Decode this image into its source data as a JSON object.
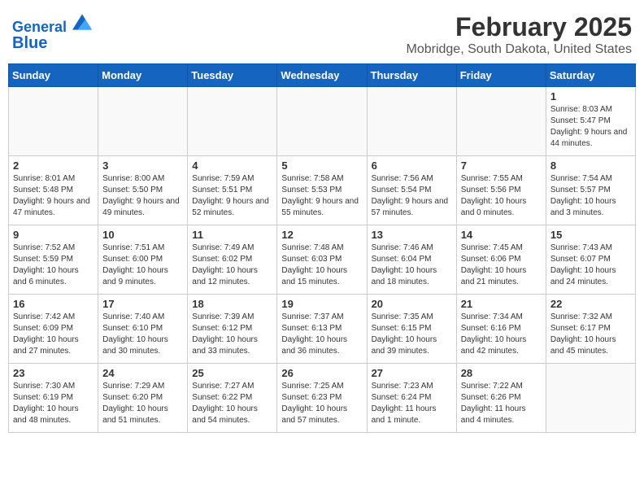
{
  "header": {
    "logo_line1": "General",
    "logo_line2": "Blue",
    "month": "February 2025",
    "location": "Mobridge, South Dakota, United States"
  },
  "days_of_week": [
    "Sunday",
    "Monday",
    "Tuesday",
    "Wednesday",
    "Thursday",
    "Friday",
    "Saturday"
  ],
  "weeks": [
    [
      {
        "day": "",
        "info": ""
      },
      {
        "day": "",
        "info": ""
      },
      {
        "day": "",
        "info": ""
      },
      {
        "day": "",
        "info": ""
      },
      {
        "day": "",
        "info": ""
      },
      {
        "day": "",
        "info": ""
      },
      {
        "day": "1",
        "info": "Sunrise: 8:03 AM\nSunset: 5:47 PM\nDaylight: 9 hours and 44 minutes."
      }
    ],
    [
      {
        "day": "2",
        "info": "Sunrise: 8:01 AM\nSunset: 5:48 PM\nDaylight: 9 hours and 47 minutes."
      },
      {
        "day": "3",
        "info": "Sunrise: 8:00 AM\nSunset: 5:50 PM\nDaylight: 9 hours and 49 minutes."
      },
      {
        "day": "4",
        "info": "Sunrise: 7:59 AM\nSunset: 5:51 PM\nDaylight: 9 hours and 52 minutes."
      },
      {
        "day": "5",
        "info": "Sunrise: 7:58 AM\nSunset: 5:53 PM\nDaylight: 9 hours and 55 minutes."
      },
      {
        "day": "6",
        "info": "Sunrise: 7:56 AM\nSunset: 5:54 PM\nDaylight: 9 hours and 57 minutes."
      },
      {
        "day": "7",
        "info": "Sunrise: 7:55 AM\nSunset: 5:56 PM\nDaylight: 10 hours and 0 minutes."
      },
      {
        "day": "8",
        "info": "Sunrise: 7:54 AM\nSunset: 5:57 PM\nDaylight: 10 hours and 3 minutes."
      }
    ],
    [
      {
        "day": "9",
        "info": "Sunrise: 7:52 AM\nSunset: 5:59 PM\nDaylight: 10 hours and 6 minutes."
      },
      {
        "day": "10",
        "info": "Sunrise: 7:51 AM\nSunset: 6:00 PM\nDaylight: 10 hours and 9 minutes."
      },
      {
        "day": "11",
        "info": "Sunrise: 7:49 AM\nSunset: 6:02 PM\nDaylight: 10 hours and 12 minutes."
      },
      {
        "day": "12",
        "info": "Sunrise: 7:48 AM\nSunset: 6:03 PM\nDaylight: 10 hours and 15 minutes."
      },
      {
        "day": "13",
        "info": "Sunrise: 7:46 AM\nSunset: 6:04 PM\nDaylight: 10 hours and 18 minutes."
      },
      {
        "day": "14",
        "info": "Sunrise: 7:45 AM\nSunset: 6:06 PM\nDaylight: 10 hours and 21 minutes."
      },
      {
        "day": "15",
        "info": "Sunrise: 7:43 AM\nSunset: 6:07 PM\nDaylight: 10 hours and 24 minutes."
      }
    ],
    [
      {
        "day": "16",
        "info": "Sunrise: 7:42 AM\nSunset: 6:09 PM\nDaylight: 10 hours and 27 minutes."
      },
      {
        "day": "17",
        "info": "Sunrise: 7:40 AM\nSunset: 6:10 PM\nDaylight: 10 hours and 30 minutes."
      },
      {
        "day": "18",
        "info": "Sunrise: 7:39 AM\nSunset: 6:12 PM\nDaylight: 10 hours and 33 minutes."
      },
      {
        "day": "19",
        "info": "Sunrise: 7:37 AM\nSunset: 6:13 PM\nDaylight: 10 hours and 36 minutes."
      },
      {
        "day": "20",
        "info": "Sunrise: 7:35 AM\nSunset: 6:15 PM\nDaylight: 10 hours and 39 minutes."
      },
      {
        "day": "21",
        "info": "Sunrise: 7:34 AM\nSunset: 6:16 PM\nDaylight: 10 hours and 42 minutes."
      },
      {
        "day": "22",
        "info": "Sunrise: 7:32 AM\nSunset: 6:17 PM\nDaylight: 10 hours and 45 minutes."
      }
    ],
    [
      {
        "day": "23",
        "info": "Sunrise: 7:30 AM\nSunset: 6:19 PM\nDaylight: 10 hours and 48 minutes."
      },
      {
        "day": "24",
        "info": "Sunrise: 7:29 AM\nSunset: 6:20 PM\nDaylight: 10 hours and 51 minutes."
      },
      {
        "day": "25",
        "info": "Sunrise: 7:27 AM\nSunset: 6:22 PM\nDaylight: 10 hours and 54 minutes."
      },
      {
        "day": "26",
        "info": "Sunrise: 7:25 AM\nSunset: 6:23 PM\nDaylight: 10 hours and 57 minutes."
      },
      {
        "day": "27",
        "info": "Sunrise: 7:23 AM\nSunset: 6:24 PM\nDaylight: 11 hours and 1 minute."
      },
      {
        "day": "28",
        "info": "Sunrise: 7:22 AM\nSunset: 6:26 PM\nDaylight: 11 hours and 4 minutes."
      },
      {
        "day": "",
        "info": ""
      }
    ]
  ]
}
